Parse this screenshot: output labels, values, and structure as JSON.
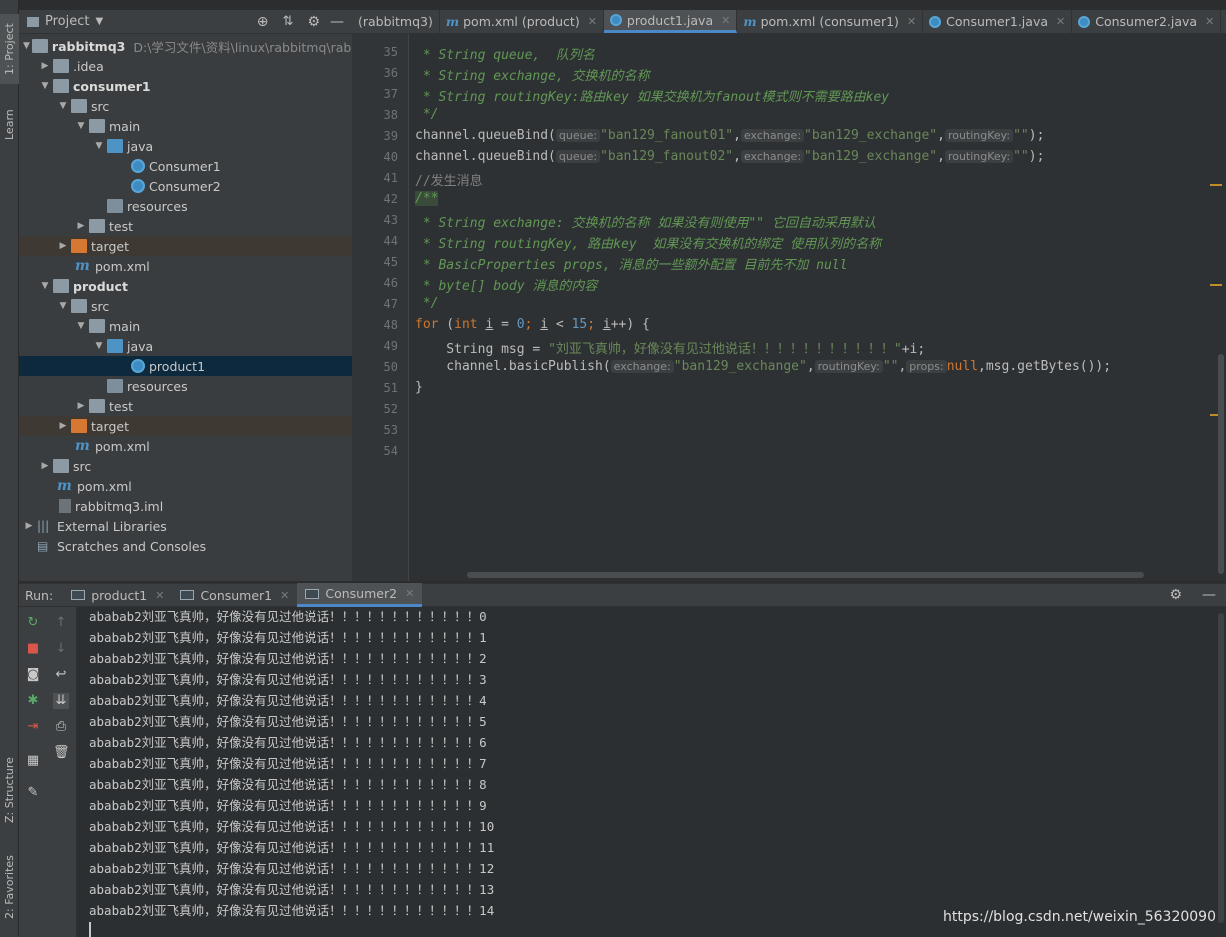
{
  "project_panel": {
    "title": "Project",
    "tree": [
      {
        "label": "rabbitmq3",
        "path": "D:\\学习文件\\资料\\linux\\rabbitmq\\rabbit"
      },
      {
        "label": ".idea"
      },
      {
        "label": "consumer1"
      },
      {
        "label": "src"
      },
      {
        "label": "main"
      },
      {
        "label": "java"
      },
      {
        "label": "Consumer1"
      },
      {
        "label": "Consumer2"
      },
      {
        "label": "resources"
      },
      {
        "label": "test"
      },
      {
        "label": "target"
      },
      {
        "label": "pom.xml"
      },
      {
        "label": "product"
      },
      {
        "label": "src"
      },
      {
        "label": "main"
      },
      {
        "label": "java"
      },
      {
        "label": "product1"
      },
      {
        "label": "resources"
      },
      {
        "label": "test"
      },
      {
        "label": "target"
      },
      {
        "label": "pom.xml"
      },
      {
        "label": "src"
      },
      {
        "label": "pom.xml"
      },
      {
        "label": "rabbitmq3.iml"
      },
      {
        "label": "External Libraries"
      },
      {
        "label": "Scratches and Consoles"
      }
    ]
  },
  "side_tabs": {
    "project": "1: Project",
    "learn": "Learn",
    "structure": "Z: Structure",
    "favorites": "2: Favorites"
  },
  "editor_tabs": [
    {
      "label": "(rabbitmq3)"
    },
    {
      "label": "pom.xml (product)"
    },
    {
      "label": "product1.java"
    },
    {
      "label": "pom.xml (consumer1)"
    },
    {
      "label": "Consumer1.java"
    },
    {
      "label": "Consumer2.java"
    }
  ],
  "code": {
    "line_numbers": [
      "35",
      "36",
      "37",
      "38",
      "39",
      "40",
      "41",
      "42",
      "43",
      "44",
      "45",
      "46",
      "47",
      "48",
      "49",
      "50",
      "51",
      "52",
      "53",
      "54"
    ],
    "l35": " * String queue,  队列名",
    "l36": " * String exchange, 交换机的名称",
    "l37": " * String routingKey:路由key 如果交换机为fanout模式则不需要路由key",
    "l38": " */",
    "l39_a": "channel.queueBind(",
    "l39_h1": "queue:",
    "l39_s1": "\"ban129_fanout01\"",
    "l39_h2": "exchange:",
    "l39_s2": "\"ban129_exchange\"",
    "l39_h3": "routingKey:",
    "l39_s3": "\"\"",
    "l39_end": ");",
    "l40_a": "channel.queueBind(",
    "l40_s1": "\"ban129_fanout02\"",
    "l41": "//发生消息",
    "l42": "/**",
    "l43": " * String exchange: 交换机的名称 如果没有则使用\"\" 它回自动采用默认",
    "l44": " * String routingKey, 路由key  如果没有交换机的绑定 使用队列的名称",
    "l45": " * BasicProperties props, 消息的一些额外配置 目前先不加 null",
    "l46": " * byte[] body 消息的内容",
    "l47": " */",
    "l48_for": "for",
    "l48_int": "int",
    "l48_i": "i",
    "l48_zero": "0",
    "l48_fifteen": "15",
    "l49_a": "    String msg = ",
    "l49_s": "\"刘亚飞真帅，好像没有见过他说话！！！！！！！！！！！\"",
    "l49_b": "+i;",
    "l50_a": "    channel.basicPublish(",
    "l50_h1": "exchange:",
    "l50_s1": "\"ban129_exchange\"",
    "l50_h2": "routingKey:",
    "l50_s2": "\"\"",
    "l50_h3": "props:",
    "l50_null": "null",
    "l50_end": ",msg.getBytes());",
    "l51": "}"
  },
  "run_panel": {
    "label": "Run:",
    "tabs": [
      {
        "label": "product1"
      },
      {
        "label": "Consumer1"
      },
      {
        "label": "Consumer2"
      }
    ],
    "lines": [
      "ababab2刘亚飞真帅，好像没有见过他说话！！！！！！！！！！！！0",
      "ababab2刘亚飞真帅，好像没有见过他说话！！！！！！！！！！！！1",
      "ababab2刘亚飞真帅，好像没有见过他说话！！！！！！！！！！！！2",
      "ababab2刘亚飞真帅，好像没有见过他说话！！！！！！！！！！！！3",
      "ababab2刘亚飞真帅，好像没有见过他说话！！！！！！！！！！！！4",
      "ababab2刘亚飞真帅，好像没有见过他说话！！！！！！！！！！！！5",
      "ababab2刘亚飞真帅，好像没有见过他说话！！！！！！！！！！！！6",
      "ababab2刘亚飞真帅，好像没有见过他说话！！！！！！！！！！！！7",
      "ababab2刘亚飞真帅，好像没有见过他说话！！！！！！！！！！！！8",
      "ababab2刘亚飞真帅，好像没有见过他说话！！！！！！！！！！！！9",
      "ababab2刘亚飞真帅，好像没有见过他说话！！！！！！！！！！！！10",
      "ababab2刘亚飞真帅，好像没有见过他说话！！！！！！！！！！！！11",
      "ababab2刘亚飞真帅，好像没有见过他说话！！！！！！！！！！！！12",
      "ababab2刘亚飞真帅，好像没有见过他说话！！！！！！！！！！！！13",
      "ababab2刘亚飞真帅，好像没有见过他说话！！！！！！！！！！！！14"
    ]
  },
  "watermark": "https://blog.csdn.net/weixin_56320090",
  "colors": {
    "accent": "#4a88c7",
    "selection": "#0d293e",
    "string": "#6a8759",
    "keyword": "#cc7832",
    "comment": "#629755"
  }
}
